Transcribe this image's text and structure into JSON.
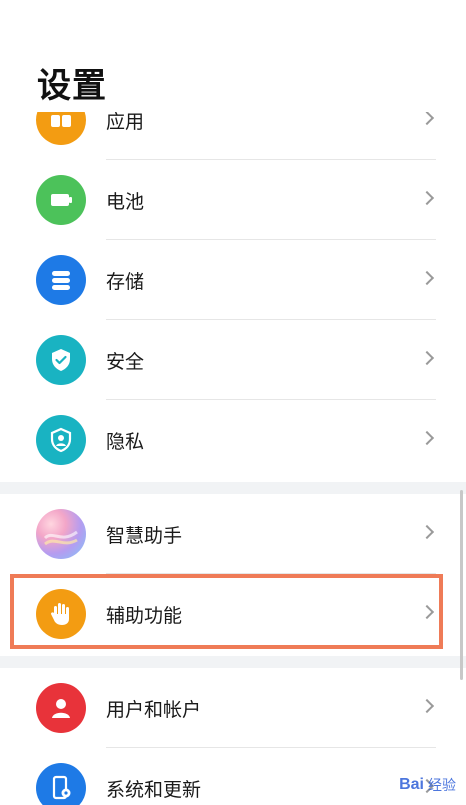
{
  "header": {
    "title": "设置"
  },
  "settings": {
    "items": [
      {
        "label": "应用",
        "icon": "apps-icon",
        "color": "#f39c12"
      },
      {
        "label": "电池",
        "icon": "battery-icon",
        "color": "#4cc25a"
      },
      {
        "label": "存储",
        "icon": "storage-icon",
        "color": "#1e7ae6"
      },
      {
        "label": "安全",
        "icon": "shield-check-icon",
        "color": "#19b3c2"
      },
      {
        "label": "隐私",
        "icon": "privacy-icon",
        "color": "#19b3c2"
      },
      {
        "label": "智慧助手",
        "icon": "assistant-icon",
        "color": "#b59cf0"
      },
      {
        "label": "辅助功能",
        "icon": "hand-icon",
        "color": "#f39c12"
      },
      {
        "label": "用户和帐户",
        "icon": "user-icon",
        "color": "#e8333a"
      },
      {
        "label": "系统和更新",
        "icon": "phone-settings-icon",
        "color": "#1e7ae6"
      }
    ]
  },
  "watermark": {
    "logo": "Bai",
    "text": "经验"
  }
}
